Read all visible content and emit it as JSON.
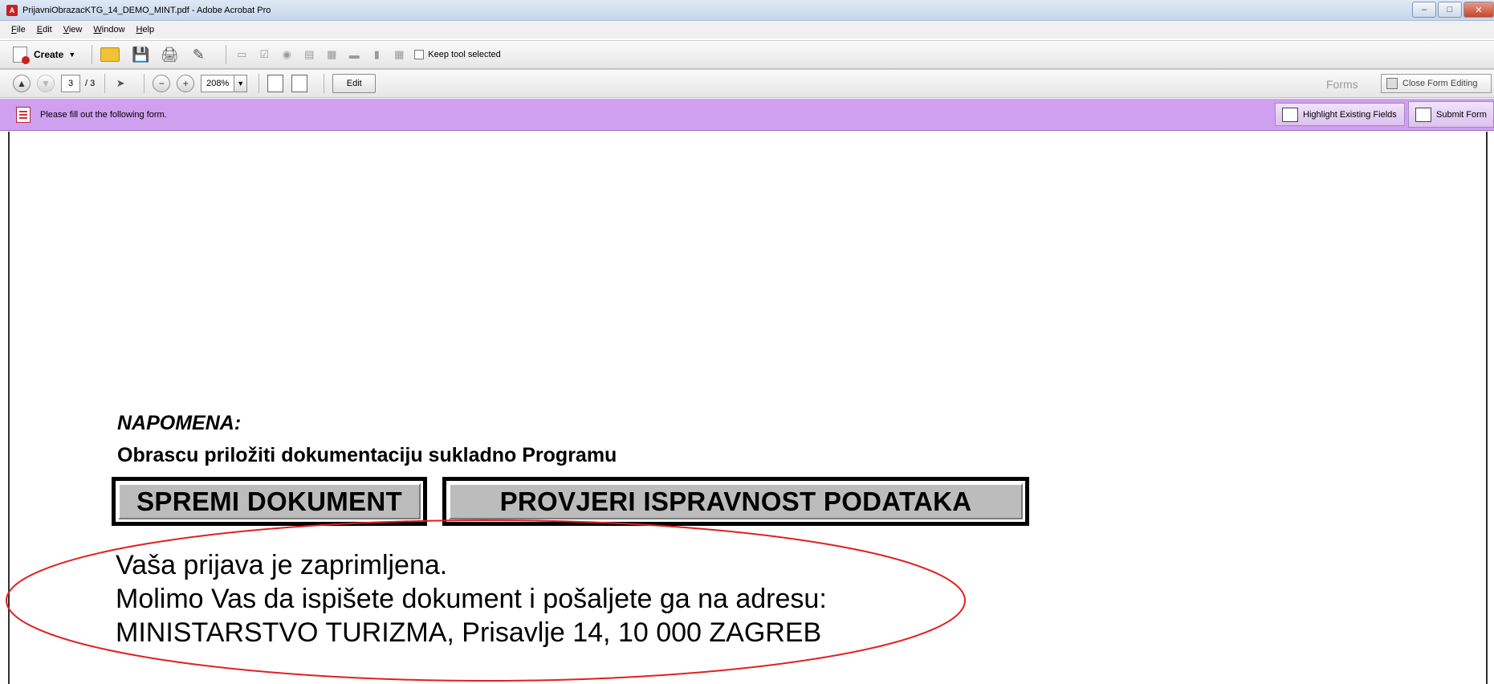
{
  "window": {
    "title": "PrijavniObrazacKTG_14_DEMO_MINT.pdf - Adobe Acrobat Pro",
    "app_icon": "adobe-acrobat-icon",
    "controls": [
      "minimize",
      "maximize",
      "close"
    ]
  },
  "menu": [
    "File",
    "Edit",
    "View",
    "Window",
    "Help"
  ],
  "toolbar1": {
    "create_label": "Create",
    "keep_tool_label": "Keep tool selected",
    "keep_tool_checked": false,
    "icons": [
      "open-folder-icon",
      "save-icon",
      "print-icon",
      "edit-document-icon",
      "text-field-icon",
      "checkbox-field-icon",
      "radio-field-icon",
      "list-box-icon",
      "dropdown-field-icon",
      "button-field-icon",
      "digital-signature-icon",
      "barcode-icon"
    ]
  },
  "toolbar2": {
    "current_page": "3",
    "total_pages": "/ 3",
    "zoom": "208%",
    "edit_label": "Edit",
    "forms_label": "Forms",
    "close_form_editing_label": "Close Form Editing"
  },
  "formbar": {
    "message": "Please fill out the following form.",
    "highlight_label": "Highlight Existing Fields",
    "submit_label": "Submit Form",
    "background_color": "#cfa0f0"
  },
  "document": {
    "note_heading": "NAPOMENA:",
    "note_text": "Obrascu priložiti dokumentaciju sukladno Programu",
    "save_button": "SPREMI DOKUMENT",
    "check_button": "PROVJERI ISPRAVNOST PODATAKA",
    "message_lines": [
      "Vaša prijava je zaprimljena.",
      "Molimo Vas da ispišete dokument i pošaljete ga na adresu:",
      "MINISTARSTVO TURIZMA, Prisavlje 14, 10 000 ZAGREB"
    ],
    "annotation_color": "#e02020"
  }
}
